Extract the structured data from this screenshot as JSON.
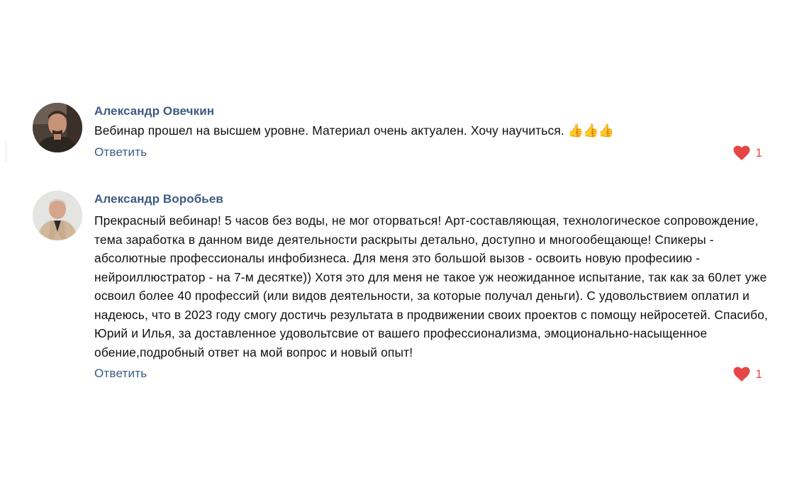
{
  "comments": [
    {
      "author": "Александр Овечкин",
      "text": "Вебинар прошел на высшем уровне. Материал очень актуален. Хочу научиться. ",
      "emoji": "👍👍👍",
      "reply_label": "Ответить",
      "likes": "1",
      "avatar_icon": "user-photo-icon"
    },
    {
      "author": "Александр Воробьев",
      "text": "Прекрасный вебинар! 5 часов без воды, не мог оторваться! Арт-составляющая, технологическое сопровождение, тема заработка в данном виде деятельности раскрыты детально, доступно и многообещающе! Спикеры - абсолютные профессионалы инфобизнеса. Для меня это большой вызов - освоить новую професиию - нейроиллюстратор - на 7-м десятке)) Хотя это для меня не такое уж неожиданное испытание, так как за 60лет уже освоил более 40 профессий (или видов деятельности, за которые получал деньги). С удовольствием оплатил и надеюсь, что в 2023 году смогу достичь результата в продвижении своих проектов с помощу нейросетей. Спасибо, Юрий и Илья, за доставленное удовольтсвие от вашего профессионализма, эмоционально-насыщенное обение,подробный ответ на мой вопрос и новый опыт!",
      "reply_label": "Ответить",
      "likes": "1",
      "avatar_icon": "user-photo-icon"
    }
  ],
  "colors": {
    "author": "#3c5b83",
    "link": "#3c5b83",
    "like": "#e64646",
    "text": "#111111",
    "background": "#ffffff"
  },
  "icons": {
    "like": "heart-icon"
  }
}
